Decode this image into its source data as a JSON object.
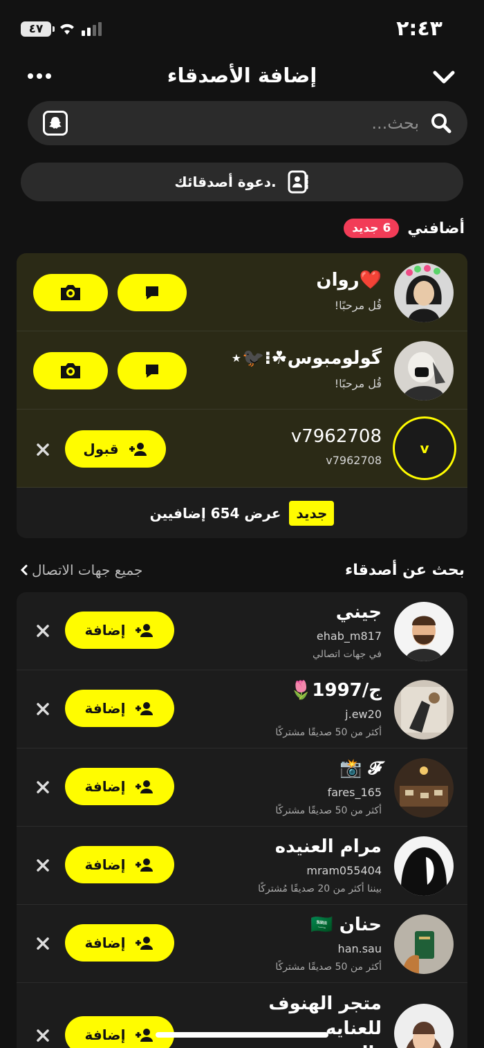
{
  "status_bar": {
    "battery": "٤٧",
    "time": "٢:٤٣"
  },
  "header": {
    "title": "إضافة الأصدقاء"
  },
  "search": {
    "placeholder": "بحث..."
  },
  "invite": {
    "label": "دعوة أصدقائك."
  },
  "added_me": {
    "heading": "أضافني",
    "new_badge": "6 جديد",
    "rows": [
      {
        "name": "❤️روان",
        "sub": "قُل مرحبًا!",
        "type": "chat"
      },
      {
        "name": "گولومبوس☘︎⁝🐦‍⬛⋆",
        "sub": "قُل مرحبًا!",
        "type": "chat"
      },
      {
        "name": "v7962708",
        "sub": "v7962708",
        "initial": "v",
        "type": "accept",
        "accept_label": "قبول"
      }
    ],
    "view_more": {
      "tag": "جديد",
      "label": "عرض 654 إضافيين"
    }
  },
  "find_friends": {
    "heading": "بحث عن أصدقاء",
    "all_contacts": "جميع جهات الاتصال",
    "add_label": "إضافة",
    "rows": [
      {
        "name": "جيني",
        "username": "ehab_m817",
        "context": "في جهات اتصالي"
      },
      {
        "name": "ج/1997🌷",
        "username": "j.ew20",
        "context": "أكثر من 50 صديقًا مشتركًا"
      },
      {
        "name": "𝓕 📸",
        "username": "fares_165",
        "context": "أكثر من 50 صديقًا مشتركًا"
      },
      {
        "name": "مرام العنيده",
        "username": "mram055404",
        "context": "بيننا أكثر من 20 صديقًا مُشتركًا"
      },
      {
        "name": "حنان 🇸🇦",
        "username": "han.sau",
        "context": "أكثر من 50 صديقًا مشتركًا"
      },
      {
        "name": "متجر الهنوف للعنايه بالشعر",
        "username": "",
        "context": ""
      }
    ]
  },
  "colors": {
    "accent": "#fffc00",
    "badge": "#f23c57",
    "background": "#121212",
    "card": "#1c1c1c",
    "highlight_row": "#2b2a16"
  }
}
